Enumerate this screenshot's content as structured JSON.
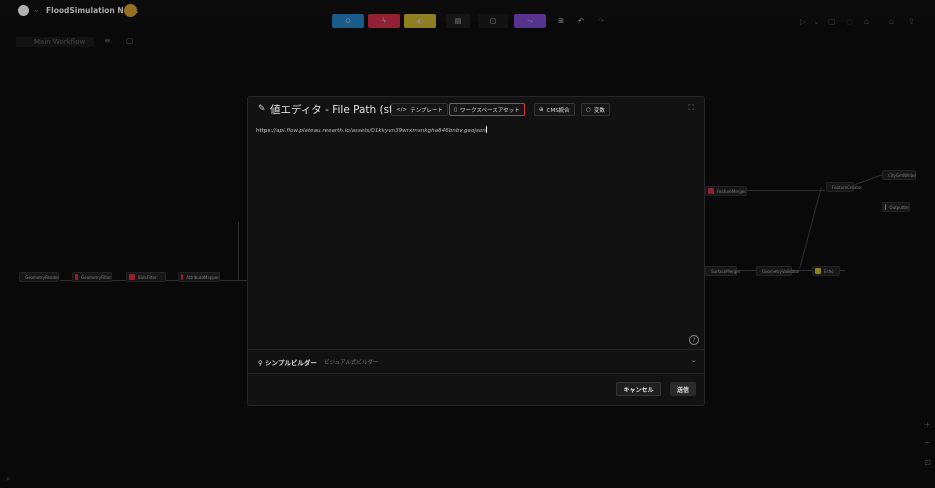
{
  "header": {
    "project_name": "FloodSimulation New.",
    "workflow_tab": "Main Workflow"
  },
  "colors": {
    "accent_red": "#d9372c",
    "tool_blue": "#1f6fa8",
    "tool_red": "#b0283d",
    "tool_yellow": "#b09a2a",
    "tool_purple": "#6b3fb0"
  },
  "icons": {
    "toolbar": [
      "reader-icon",
      "transformer-icon",
      "writer-icon",
      "note-icon",
      "batch-icon",
      "subworkflow-icon",
      "layout-icon",
      "undo-icon",
      "redo-icon"
    ]
  },
  "nodes": [
    {
      "label": "GeometryReader",
      "color": "#1f6fa8"
    },
    {
      "label": "GeometryFilter",
      "color": "#b0283d"
    },
    {
      "label": "BulkFilter",
      "color": "#b0283d"
    },
    {
      "label": "AttributeMapper",
      "color": "#b0283d"
    },
    {
      "label": "FeatureMerger",
      "color": "#b0283d"
    },
    {
      "label": "FeatureCreator",
      "color": "#b0283d"
    },
    {
      "label": "SurfaceMerger",
      "color": "#b0283d"
    },
    {
      "label": "CityGmlWriter",
      "color": "#b09a2a"
    },
    {
      "label": "NoopOutput",
      "color": "#b09a2a"
    },
    {
      "label": "Echo",
      "color": "#b09a2a"
    },
    {
      "label": "GeometryValidator",
      "color": "#b0283d"
    },
    {
      "label": "Outputter",
      "color": "#b09a2a"
    }
  ],
  "dialog": {
    "title": "値エディタ - File Path (string)",
    "tabs": [
      {
        "label": "テンプレート",
        "icon": "code-icon"
      },
      {
        "label": "ワークスペースアセット",
        "icon": "file-icon",
        "active": true
      },
      {
        "label": "CMS統合",
        "icon": "globe-icon"
      },
      {
        "label": "変数",
        "icon": "circle-icon"
      }
    ],
    "value_prefix": "https:",
    "value_rest": "//api.flow.plateau.reearth.io/assets/01kkyvn39wrxmsnkgha846bnbv.geojson",
    "builder_label": "シンプルビルダー",
    "builder_sub": "ビジュアル式ビルダー",
    "cancel": "キャンセル",
    "submit": "送信"
  }
}
